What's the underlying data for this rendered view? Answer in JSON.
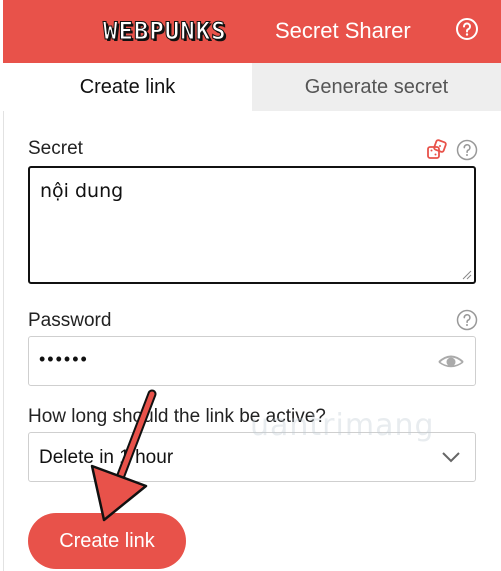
{
  "header": {
    "logo_text": "WEBPUNKS",
    "title": "Secret Sharer",
    "help_icon": "question-circle-icon",
    "background": "#e8524a"
  },
  "tabs": [
    {
      "label": "Create link",
      "active": true
    },
    {
      "label": "Generate secret",
      "active": false
    }
  ],
  "secret": {
    "label": "Secret",
    "value": "nội dung",
    "generate_icon": "dice-icon",
    "help_icon": "question-circle-icon"
  },
  "password": {
    "label": "Password",
    "value": "••••••",
    "toggle_icon": "eye-icon",
    "help_icon": "question-circle-icon"
  },
  "expiry": {
    "label": "How long should the link be active?",
    "selected": "Delete in 1 hour",
    "dropdown_icon": "chevron-down-icon"
  },
  "actions": {
    "create_label": "Create link"
  },
  "overlay": {
    "watermark": "uantrimang",
    "annotation_icon": "red-arrow-icon"
  },
  "colors": {
    "accent": "#e8524a",
    "inactive_tab": "#eeeeee"
  }
}
